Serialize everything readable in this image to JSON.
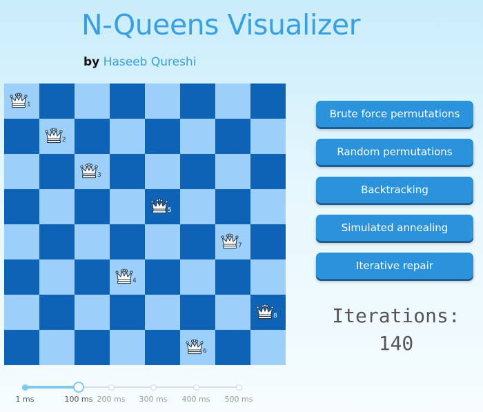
{
  "header": {
    "title": "N-Queens Visualizer",
    "by": "by",
    "author": "Haseeb Qureshi",
    "title_color": "#3a9fe2"
  },
  "board": {
    "size": 8,
    "dark_color": "#0e63b6",
    "light_color": "#9ccff9",
    "queen_icon": "queen-crown-icon",
    "queens": [
      {
        "row": 0,
        "col": 0,
        "label": "1"
      },
      {
        "row": 1,
        "col": 1,
        "label": "2"
      },
      {
        "row": 2,
        "col": 2,
        "label": "3"
      },
      {
        "row": 3,
        "col": 4,
        "label": "5"
      },
      {
        "row": 4,
        "col": 6,
        "label": "7"
      },
      {
        "row": 5,
        "col": 3,
        "label": "4"
      },
      {
        "row": 6,
        "col": 7,
        "label": "8"
      },
      {
        "row": 7,
        "col": 5,
        "label": "6"
      }
    ]
  },
  "controls": {
    "buttons": [
      "Brute force permutations",
      "Random permutations",
      "Backtracking",
      "Simulated annealing",
      "Iterative repair"
    ],
    "button_color": "#2b93db"
  },
  "iterations": {
    "label": "Iterations:",
    "value": "140"
  },
  "speed_slider": {
    "labels": [
      "1 ms",
      "100 ms",
      "200 ms",
      "300 ms",
      "400 ms",
      "500 ms"
    ],
    "selected_index": 1,
    "accent_color": "#7ec8f2"
  }
}
